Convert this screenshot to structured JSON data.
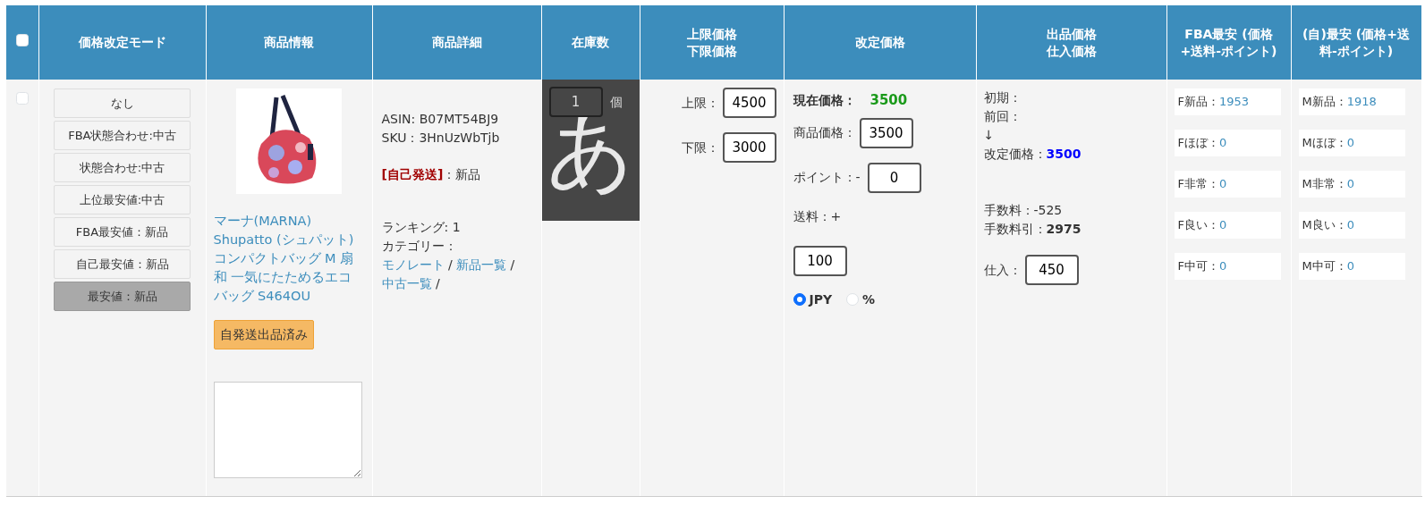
{
  "header": {
    "select_all": {
      "checked": false
    },
    "columns": [
      {
        "lines": [
          "価格改定モード"
        ]
      },
      {
        "lines": [
          "商品情報"
        ]
      },
      {
        "lines": [
          "商品詳細"
        ]
      },
      {
        "lines": [
          "在庫数"
        ]
      },
      {
        "lines": [
          "上限価格",
          "下限価格"
        ]
      },
      {
        "lines": [
          "改定価格"
        ]
      },
      {
        "lines": [
          "出品価格",
          "仕入価格"
        ]
      },
      {
        "lines": [
          "FBA最安 (価格+送料-ポイント)"
        ]
      },
      {
        "lines": [
          "(自)最安 (価格+送料-ポイント)"
        ]
      }
    ]
  },
  "row": {
    "checked": false,
    "modes": [
      {
        "label": "なし",
        "selected": false
      },
      {
        "label": "FBA状態合わせ:中古",
        "selected": false
      },
      {
        "label": "状態合わせ:中古",
        "selected": false
      },
      {
        "label": "上位最安値:中古",
        "selected": false
      },
      {
        "label": "FBA最安値：新品",
        "selected": false
      },
      {
        "label": "自己最安値：新品",
        "selected": false
      },
      {
        "label": "最安値：新品",
        "selected": true
      }
    ],
    "product": {
      "title": "マーナ(MARNA) Shupatto (シュパット) コンパクトバッグ M 扇和 一気にたためるエコバッグ S464OU",
      "status_button": "自発送出品済み",
      "memo": {
        "kind": "textarea"
      }
    },
    "detail": {
      "asin": "ASIN: B07MT54BJ9",
      "sku": "SKU：3HnUzWbTjb",
      "ship_type": "[自己発送]",
      "condition": "：新品",
      "ranking": "ランキング: 1",
      "category_label": "カテゴリー：",
      "category_items": [
        {
          "kind": "link",
          "text": "モノレート"
        },
        {
          "kind": "text",
          "text": "/"
        },
        {
          "kind": "link",
          "text": "新品一覧"
        },
        {
          "kind": "text",
          "text": "/"
        },
        {
          "kind": "link",
          "text": "中古一覧"
        },
        {
          "kind": "text",
          "text": "/"
        }
      ]
    },
    "stock": {
      "value": "1",
      "unit": "個",
      "ime_overlay": "あ"
    },
    "limits": {
      "upper_label": "上限：",
      "upper": "4500",
      "lower_label": "下限：",
      "lower": "3000"
    },
    "revision": {
      "current_label": "現在価格：",
      "current": "3500",
      "price_label": "商品価格：",
      "price": "3500",
      "point_label": "ポイント：-",
      "point": "0",
      "shipping_label": "送料：+",
      "shipping": "100",
      "units": [
        {
          "label": "JPY",
          "selected": true
        },
        {
          "label": "%",
          "selected": false
        }
      ]
    },
    "listing": {
      "initial": "初期：",
      "previous": "前回：",
      "arrow": "↓",
      "revised_label": "改定価格：",
      "revised": "3500",
      "fee": "手数料：-525",
      "fee_net_label": "手数料引：",
      "fee_net": "2975",
      "cost_label": "仕入：",
      "cost": "450"
    },
    "fba_lowest": [
      {
        "label": "F新品：",
        "value": "1953"
      },
      {
        "label": "Fほぼ：",
        "value": "0"
      },
      {
        "label": "F非常：",
        "value": "0"
      },
      {
        "label": "F良い：",
        "value": "0"
      },
      {
        "label": "F中可：",
        "value": "0"
      }
    ],
    "self_lowest": [
      {
        "label": "M新品：",
        "value": "1918"
      },
      {
        "label": "Mほぼ：",
        "value": "0"
      },
      {
        "label": "M非常：",
        "value": "0"
      },
      {
        "label": "M良い：",
        "value": "0"
      },
      {
        "label": "M中可：",
        "value": "0"
      }
    ]
  }
}
